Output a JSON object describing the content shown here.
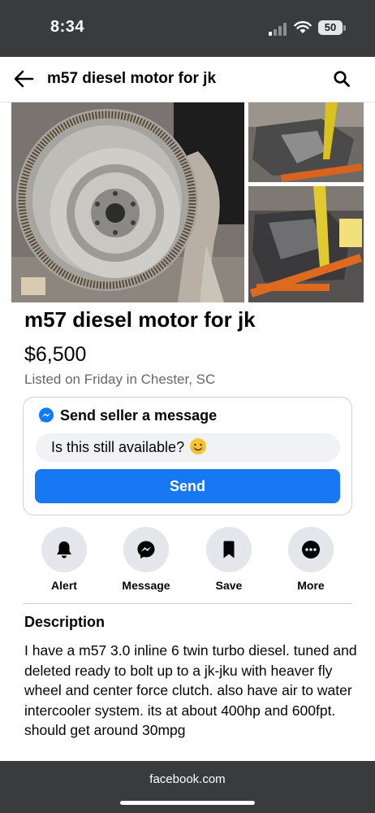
{
  "status_bar": {
    "time": "8:34",
    "battery": "50"
  },
  "header": {
    "title": "m57 diesel motor for jk"
  },
  "listing": {
    "title": "m57 diesel motor for jk",
    "price": "$6,500",
    "listed": "Listed on Friday in Chester, SC"
  },
  "message_card": {
    "title": "Send seller a message",
    "input_value": "Is this still available?",
    "send_label": "Send"
  },
  "actions": [
    {
      "label": "Alert",
      "icon": "bell-icon"
    },
    {
      "label": "Message",
      "icon": "messenger-icon"
    },
    {
      "label": "Save",
      "icon": "bookmark-icon"
    },
    {
      "label": "More",
      "icon": "more-icon"
    }
  ],
  "description": {
    "heading": "Description",
    "text": "I have a m57 3.0 inline 6 twin turbo diesel. tuned and deleted ready to bolt up to a jk-jku with heaver fly wheel and center force clutch. also have air to water intercooler system. its at about 400hp and 600fpt. should get around 30mpg"
  },
  "browser": {
    "url": "facebook.com"
  },
  "colors": {
    "accent": "#1877f2",
    "chrome": "#3a3b3c",
    "secondary_text": "#65676b"
  }
}
